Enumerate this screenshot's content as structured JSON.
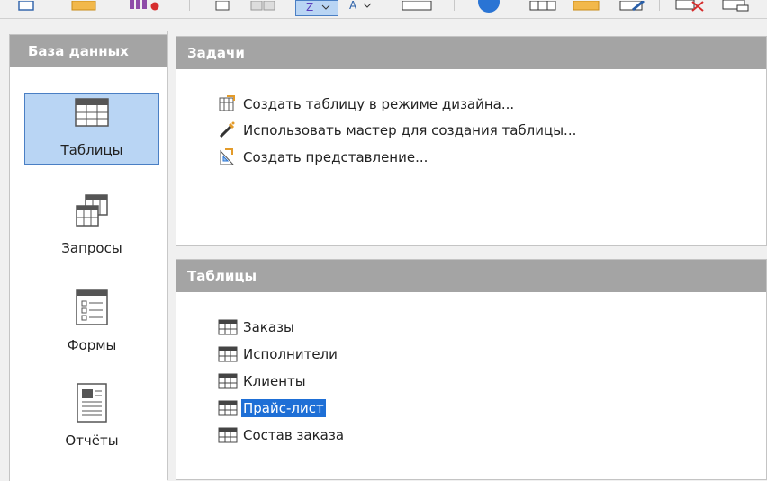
{
  "left_panel": {
    "title": "База данных",
    "items": [
      {
        "label": "Таблицы",
        "icon": "table-icon",
        "active": true
      },
      {
        "label": "Запросы",
        "icon": "queries-icon",
        "active": false
      },
      {
        "label": "Формы",
        "icon": "forms-icon",
        "active": false
      },
      {
        "label": "Отчёты",
        "icon": "reports-icon",
        "active": false
      }
    ]
  },
  "tasks_panel": {
    "title": "Задачи",
    "items": [
      {
        "label": "Создать таблицу в режиме дизайна...",
        "icon": "design-table-icon"
      },
      {
        "label": "Использовать мастер для создания таблицы...",
        "icon": "wizard-wand-icon"
      },
      {
        "label": "Создать представление...",
        "icon": "create-view-icon"
      }
    ]
  },
  "tables_panel": {
    "title": "Таблицы",
    "items": [
      {
        "label": "Заказы",
        "selected": false
      },
      {
        "label": "Исполнители",
        "selected": false
      },
      {
        "label": "Клиенты",
        "selected": false
      },
      {
        "label": "Прайс-лист",
        "selected": true
      },
      {
        "label": "Состав заказа",
        "selected": false
      }
    ]
  },
  "colors": {
    "header_bg": "#a4a4a4",
    "selection_bg": "#1e6fd6",
    "active_nav_bg": "#b9d5f4"
  }
}
